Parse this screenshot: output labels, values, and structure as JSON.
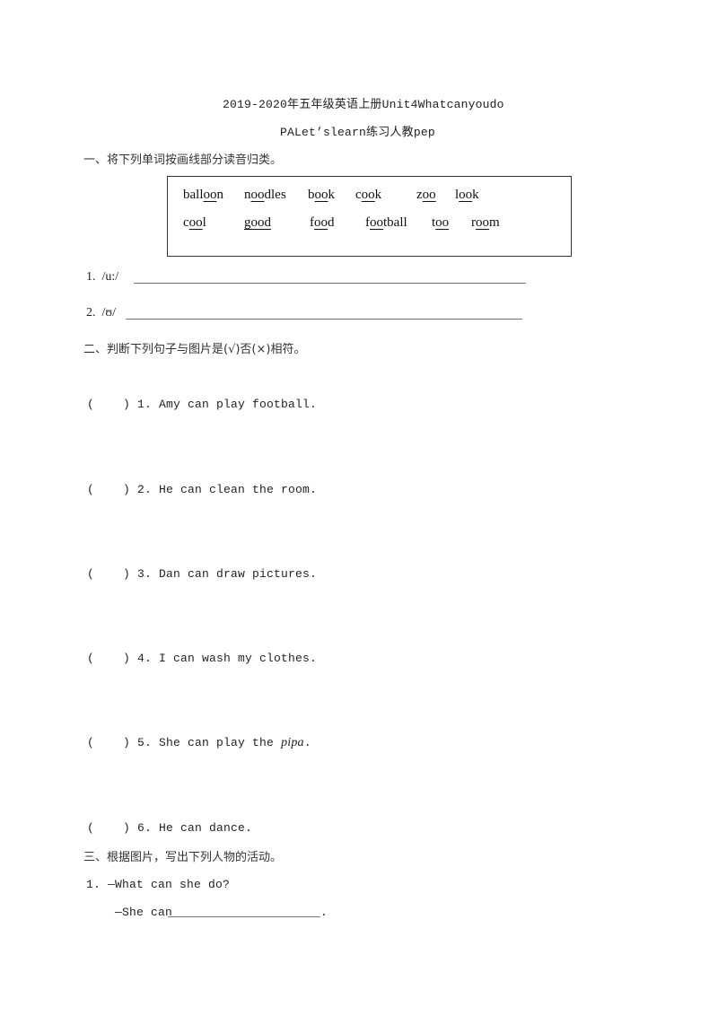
{
  "header": {
    "title_line1": "2019-2020年五年级英语上册Unit4Whatcanyoudo",
    "title_line2": "PALet’slearn练习人教pep"
  },
  "section1": {
    "heading": "一、将下列单词按画线部分读音归类。",
    "words_row1": [
      {
        "pre": "ball",
        "u": "oo",
        "post": "n"
      },
      {
        "pre": "n",
        "u": "oo",
        "post": "dles"
      },
      {
        "pre": "b",
        "u": "oo",
        "post": "k"
      },
      {
        "pre": "c",
        "u": "oo",
        "post": "k"
      },
      {
        "pre": "z",
        "u": "oo",
        "post": ""
      },
      {
        "pre": "l",
        "u": "oo",
        "post": "k"
      }
    ],
    "words_row2": [
      {
        "pre": "c",
        "u": "oo",
        "post": "l"
      },
      {
        "pre": "",
        "u": "good",
        "post": ""
      },
      {
        "pre": "f",
        "u": "oo",
        "post": "d"
      },
      {
        "pre": "f",
        "u": "oo",
        "post": "tball"
      },
      {
        "pre": "t",
        "u": "oo",
        "post": ""
      },
      {
        "pre": "r",
        "u": "oo",
        "post": "m"
      }
    ],
    "answers": [
      {
        "label": "1.  /u:/"
      },
      {
        "label": "2.  /ʊ/"
      }
    ]
  },
  "section2": {
    "heading": "二、判断下列句子与图片是(√)否(×)相符。",
    "items": [
      {
        "paren": "(    )",
        "text": "1. Amy can play football.",
        "italic": ""
      },
      {
        "paren": "(    )",
        "text": "2. He can clean the room.",
        "italic": ""
      },
      {
        "paren": "(    )",
        "text": "3. Dan can draw pictures.",
        "italic": ""
      },
      {
        "paren": "(    )",
        "text": "4. I can wash my clothes.",
        "italic": ""
      },
      {
        "paren": "(    )",
        "text": "5. She can play the ",
        "italic": "pipa",
        "tail": "."
      },
      {
        "paren": "(    )",
        "text": "6. He can dance.",
        "italic": ""
      }
    ]
  },
  "section3": {
    "heading": "三、根据图片，写出下列人物的活动。",
    "q1_question": "1. —What can she do?",
    "q1_answer_prefix": "—She can",
    "q1_answer_suffix": "."
  }
}
